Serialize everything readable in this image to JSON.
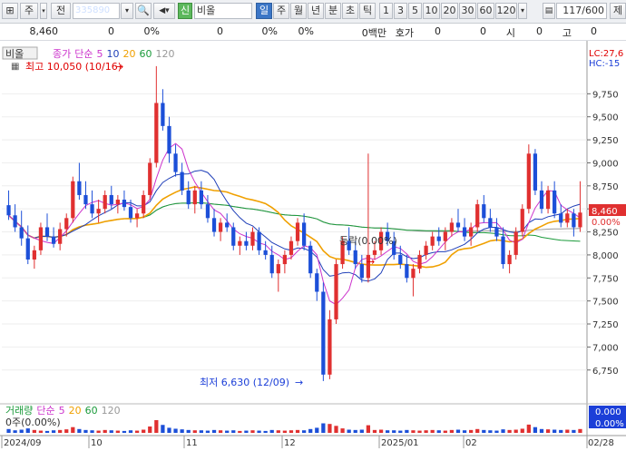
{
  "toolbar": {
    "market_label": "주",
    "tab_all": "전",
    "code": "335890",
    "stock_name": "비올",
    "period_labels": [
      "일",
      "주",
      "월",
      "년",
      "분",
      "초",
      "틱"
    ],
    "interval_labels": [
      "1",
      "3",
      "5",
      "10",
      "20",
      "30",
      "60",
      "120"
    ],
    "page_counter": "117/600",
    "reset_label": "제"
  },
  "info_row": {
    "price": "8,460",
    "v1": "0",
    "p1": "0%",
    "v2": "0",
    "p2": "0%",
    "p3": "0%",
    "unit_label": "0백만",
    "quote_label": "호가",
    "q1": "0",
    "q2": "0",
    "open_label": "시",
    "o1": "0",
    "high_label": "고",
    "h1": "0"
  },
  "chart_data": {
    "type": "candlestick",
    "legend_stock": "비올",
    "legend_ma": "종가 단순 5 10 20 60 120",
    "ma_periods": [
      "5",
      "10",
      "20",
      "60",
      "120"
    ],
    "ma_colors": {
      "5": "#cc33cc",
      "10": "#1f3fb8",
      "20": "#f0a000",
      "60": "#1a9a3a",
      "120": "#999999"
    },
    "y_ticks": [
      9750,
      9500,
      9250,
      9000,
      8750,
      8500,
      8250,
      8000,
      7750,
      7500,
      7250,
      7000,
      6750
    ],
    "y_tick_labels": [
      "9,750",
      "9,500",
      "9,250",
      "9,000",
      "8,750",
      "8,500",
      "8,250",
      "8,000",
      "7,750",
      "7,500",
      "7,250",
      "7,000",
      "6,750"
    ],
    "ylim": [
      6580,
      9980
    ],
    "x_labels": [
      "2024/09",
      "10",
      "11",
      "12",
      "2025/01",
      "02",
      "02/28"
    ],
    "high_annotation": "최고 10,050 (10/16)",
    "low_annotation": "최저 6,630 (12/09)",
    "mid_annotation": "등락(0.00%)",
    "lc_label": "LC:27,6",
    "hc_label": "HC:-15",
    "current_price": "8,460",
    "current_change": "0.00%",
    "volume_legend": "거래량 단순 5 20 60 120",
    "volume_value": "0주(0.00%)",
    "volume_axis_label": "0.000",
    "volume_axis_pct": "0.00%",
    "up_color": "#e03030",
    "down_color": "#1c4fd8",
    "candles": [
      [
        8540,
        8700,
        8380,
        8430
      ],
      [
        8430,
        8550,
        8250,
        8300
      ],
      [
        8300,
        8480,
        8100,
        8180
      ],
      [
        8180,
        8320,
        7900,
        7950
      ],
      [
        7950,
        8100,
        7850,
        8050
      ],
      [
        8050,
        8350,
        8000,
        8300
      ],
      [
        8300,
        8450,
        8150,
        8200
      ],
      [
        8200,
        8300,
        8080,
        8120
      ],
      [
        8120,
        8350,
        8050,
        8280
      ],
      [
        8280,
        8450,
        8200,
        8400
      ],
      [
        8400,
        8850,
        8350,
        8800
      ],
      [
        8800,
        9000,
        8600,
        8650
      ],
      [
        8650,
        8800,
        8500,
        8550
      ],
      [
        8550,
        8700,
        8400,
        8450
      ],
      [
        8450,
        8600,
        8350,
        8500
      ],
      [
        8500,
        8700,
        8450,
        8650
      ],
      [
        8650,
        8750,
        8500,
        8550
      ],
      [
        8550,
        8650,
        8450,
        8600
      ],
      [
        8600,
        8700,
        8480,
        8520
      ],
      [
        8520,
        8600,
        8350,
        8400
      ],
      [
        8400,
        8500,
        8300,
        8450
      ],
      [
        8450,
        8700,
        8400,
        8650
      ],
      [
        8650,
        9050,
        8600,
        9000
      ],
      [
        9000,
        10050,
        8950,
        9650
      ],
      [
        9650,
        9800,
        9350,
        9400
      ],
      [
        9400,
        9500,
        9000,
        9100
      ],
      [
        9100,
        9200,
        8850,
        8900
      ],
      [
        8900,
        9000,
        8650,
        8700
      ],
      [
        8700,
        8800,
        8500,
        8550
      ],
      [
        8550,
        8750,
        8450,
        8700
      ],
      [
        8700,
        8800,
        8500,
        8550
      ],
      [
        8550,
        8650,
        8350,
        8400
      ],
      [
        8400,
        8500,
        8200,
        8250
      ],
      [
        8250,
        8400,
        8150,
        8350
      ],
      [
        8350,
        8450,
        8250,
        8300
      ],
      [
        8300,
        8350,
        8050,
        8100
      ],
      [
        8100,
        8200,
        8000,
        8150
      ],
      [
        8150,
        8250,
        8050,
        8100
      ],
      [
        8100,
        8300,
        8050,
        8250
      ],
      [
        8250,
        8300,
        8000,
        8050
      ],
      [
        8050,
        8150,
        7950,
        8000
      ],
      [
        8000,
        8100,
        7750,
        7800
      ],
      [
        7800,
        7950,
        7600,
        7900
      ],
      [
        7900,
        8050,
        7800,
        8000
      ],
      [
        8000,
        8200,
        7950,
        8150
      ],
      [
        8150,
        8400,
        8100,
        8350
      ],
      [
        8350,
        8450,
        8050,
        8100
      ],
      [
        8100,
        8150,
        7750,
        7800
      ],
      [
        7800,
        7850,
        7500,
        7600
      ],
      [
        7600,
        7700,
        6630,
        6700
      ],
      [
        6700,
        7400,
        6650,
        7300
      ],
      [
        7300,
        7950,
        7250,
        7900
      ],
      [
        7900,
        8200,
        7850,
        8150
      ],
      [
        8150,
        8300,
        8000,
        8050
      ],
      [
        8050,
        8150,
        7850,
        7900
      ],
      [
        7900,
        8000,
        7700,
        7750
      ],
      [
        7750,
        9100,
        7700,
        8000
      ],
      [
        8000,
        8150,
        7950,
        8050
      ],
      [
        8050,
        8300,
        8000,
        8250
      ],
      [
        8250,
        8350,
        8100,
        8150
      ],
      [
        8150,
        8250,
        7950,
        8000
      ],
      [
        8000,
        8100,
        7850,
        7900
      ],
      [
        7900,
        8000,
        7700,
        7750
      ],
      [
        7750,
        7900,
        7550,
        7850
      ],
      [
        7850,
        8050,
        7800,
        8000
      ],
      [
        8000,
        8150,
        7950,
        8100
      ],
      [
        8100,
        8250,
        8050,
        8200
      ],
      [
        8200,
        8300,
        8100,
        8150
      ],
      [
        8150,
        8300,
        8050,
        8250
      ],
      [
        8250,
        8400,
        8200,
        8350
      ],
      [
        8350,
        8500,
        8250,
        8300
      ],
      [
        8300,
        8400,
        8150,
        8200
      ],
      [
        8200,
        8350,
        8100,
        8300
      ],
      [
        8300,
        8600,
        8250,
        8550
      ],
      [
        8550,
        8650,
        8350,
        8400
      ],
      [
        8400,
        8500,
        8250,
        8300
      ],
      [
        8300,
        8400,
        8150,
        8200
      ],
      [
        8200,
        8300,
        7850,
        7900
      ],
      [
        7900,
        8050,
        7800,
        8000
      ],
      [
        8000,
        8300,
        7950,
        8250
      ],
      [
        8250,
        8550,
        8200,
        8500
      ],
      [
        8500,
        9200,
        8450,
        9100
      ],
      [
        9100,
        9150,
        8650,
        8700
      ],
      [
        8700,
        8800,
        8450,
        8500
      ],
      [
        8500,
        8750,
        8450,
        8700
      ],
      [
        8700,
        8800,
        8400,
        8450
      ],
      [
        8450,
        8550,
        8300,
        8350
      ],
      [
        8350,
        8500,
        8300,
        8450
      ],
      [
        8450,
        8500,
        8200,
        8300
      ],
      [
        8300,
        8800,
        8250,
        8460
      ]
    ],
    "volumes": [
      12,
      8,
      10,
      14,
      9,
      7,
      6,
      8,
      9,
      11,
      18,
      12,
      9,
      8,
      7,
      9,
      8,
      7,
      6,
      8,
      7,
      10,
      20,
      40,
      25,
      16,
      13,
      11,
      9,
      8,
      8,
      7,
      9,
      8,
      7,
      8,
      6,
      7,
      8,
      7,
      6,
      9,
      8,
      7,
      8,
      9,
      8,
      12,
      16,
      30,
      28,
      22,
      14,
      10,
      9,
      10,
      24,
      9,
      10,
      8,
      8,
      7,
      9,
      8,
      7,
      8,
      9,
      8,
      7,
      9,
      10,
      8,
      9,
      12,
      9,
      8,
      7,
      11,
      9,
      10,
      13,
      26,
      18,
      12,
      11,
      10,
      9,
      10,
      9,
      12
    ]
  }
}
